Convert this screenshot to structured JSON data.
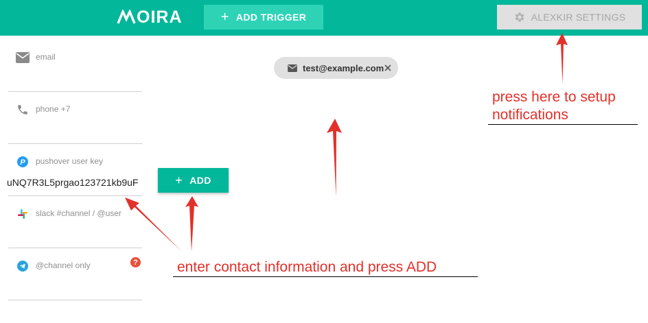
{
  "header": {
    "logo_text": "OIRA",
    "add_trigger_label": "ADD TRIGGER",
    "settings_label": "ALEXKIR SETTINGS"
  },
  "contacts": {
    "fields": [
      {
        "label": "email",
        "value": "",
        "icon": "mail-icon"
      },
      {
        "label": "phone +7",
        "value": "",
        "icon": "phone-icon"
      },
      {
        "label": "pushover user key",
        "value": "uNQ7R3L5prgao123721kb9uF",
        "icon": "pushover-icon"
      },
      {
        "label": "slack #channel / @user",
        "value": "",
        "icon": "slack-icon"
      },
      {
        "label": "@channel only",
        "value": "",
        "icon": "telegram-icon",
        "help": "?"
      }
    ],
    "add_label": "ADD"
  },
  "chip": {
    "text": "test@example.com"
  },
  "annotations": {
    "settings_hint": "press here to setup notifications",
    "add_hint": "enter contact information and press ADD"
  },
  "colors": {
    "header": "#03b79a",
    "add_trigger": "#2ed3b6",
    "annotation": "#e2302a"
  }
}
